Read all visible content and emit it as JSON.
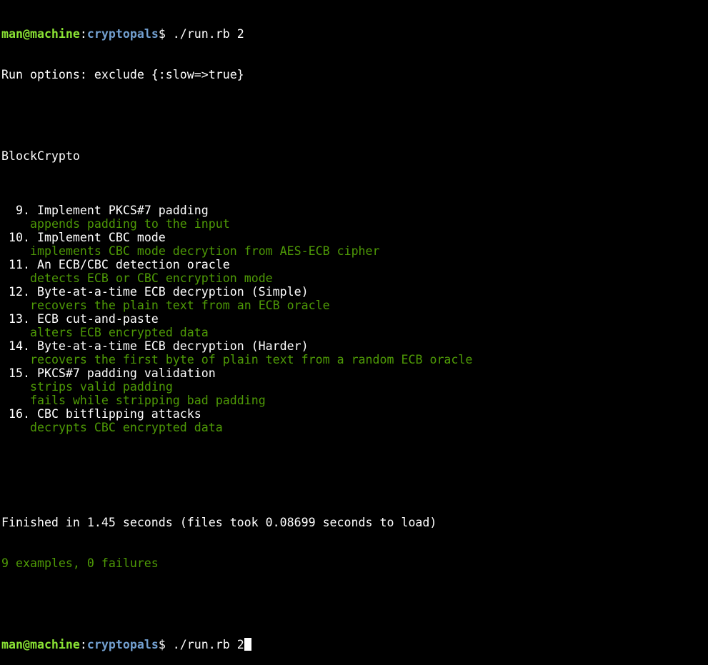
{
  "colors": {
    "background": "#000000",
    "text": "#ffffff",
    "pass_green": "#4e9a06",
    "prompt_user": "#8ae234",
    "prompt_dir": "#729fcf"
  },
  "prompt": {
    "user_host": "man@machine",
    "separator": ":",
    "directory": "cryptopals",
    "symbol": "$",
    "command_first": " ./run.rb 2",
    "command_current": " ./run.rb 2"
  },
  "run_options": "Run options: exclude {:slow=>true}",
  "suite_title": "BlockCrypto",
  "tests": [
    {
      "label": "9. Implement PKCS#7 padding",
      "indent": "1",
      "examples": [
        "appends padding to the input"
      ]
    },
    {
      "label": "10. Implement CBC mode",
      "indent": "1b",
      "examples": [
        "implements CBC mode decrytion from AES-ECB cipher"
      ]
    },
    {
      "label": "11. An ECB/CBC detection oracle",
      "indent": "1b",
      "examples": [
        "detects ECB or CBC encryption mode"
      ]
    },
    {
      "label": "12. Byte-at-a-time ECB decryption (Simple)",
      "indent": "1b",
      "examples": [
        "recovers the plain text from an ECB oracle"
      ]
    },
    {
      "label": "13. ECB cut-and-paste",
      "indent": "1b",
      "examples": [
        "alters ECB encrypted data"
      ]
    },
    {
      "label": "14. Byte-at-a-time ECB decryption (Harder)",
      "indent": "1b",
      "examples": [
        "recovers the first byte of plain text from a random ECB oracle"
      ]
    },
    {
      "label": "15. PKCS#7 padding validation",
      "indent": "1b",
      "examples": [
        "strips valid padding",
        "fails while stripping bad padding"
      ]
    },
    {
      "label": "16. CBC bitflipping attacks",
      "indent": "1b",
      "examples": [
        "decrypts CBC encrypted data"
      ]
    }
  ],
  "finished_line": "Finished in 1.45 seconds (files took 0.08699 seconds to load)",
  "summary_line": "9 examples, 0 failures"
}
